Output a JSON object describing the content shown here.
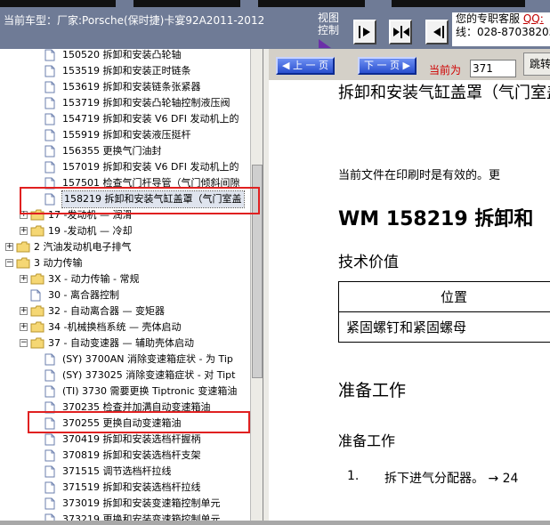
{
  "header": {
    "vehicle_label": "当前车型：厂家:Porsche(保时捷)卡宴92A2011-2012",
    "view_control_label": "视图控制",
    "contact_line1_prefix": "您的专职客服",
    "contact_line1_link": "QQ:",
    "contact_line2": "线：028-87038205"
  },
  "tree": {
    "items": [
      {
        "label": "150520 拆卸和安装凸轮轴",
        "type": "doc"
      },
      {
        "label": "153519 拆卸和安装正时链条",
        "type": "doc"
      },
      {
        "label": "153619 拆卸和安装链条张紧器",
        "type": "doc"
      },
      {
        "label": "153719 拆卸和安装凸轮轴控制液压阀",
        "type": "doc"
      },
      {
        "label": "154719 拆卸和安装 V6 DFI 发动机上的",
        "type": "doc"
      },
      {
        "label": "155919 拆卸和安装液压挺杆",
        "type": "doc"
      },
      {
        "label": "156355 更换气门油封",
        "type": "doc"
      },
      {
        "label": "157019 拆卸和安装 V6 DFI 发动机上的",
        "type": "doc"
      },
      {
        "label": "157501 检查气门杆导管（气门倾斜间隙",
        "type": "doc"
      },
      {
        "label": "158219 拆卸和安装气缸盖罩（气门室盖",
        "type": "doc",
        "selected": true
      },
      {
        "label": "17 -发动机 — 润滑",
        "type": "folder"
      },
      {
        "label": "19 -发动机 — 冷却",
        "type": "folder"
      },
      {
        "label": "2 汽油发动机电子排气",
        "type": "folder"
      },
      {
        "label": "3 动力传输",
        "type": "folder"
      },
      {
        "label": "3X - 动力传输 - 常规",
        "type": "folder"
      },
      {
        "label": "30 - 离合器控制",
        "type": "doc"
      },
      {
        "label": "32 - 自动离合器 — 变矩器",
        "type": "folder"
      },
      {
        "label": "34 -机械换档系统 — 壳体启动",
        "type": "folder"
      },
      {
        "label": "37 - 自动变速器 — 辅助壳体启动",
        "type": "folder"
      },
      {
        "label": "(SY) 3700AN 消除变速箱症状 - 为 Tip",
        "type": "doc"
      },
      {
        "label": "(SY) 373025 消除变速箱症状 - 对 Tipt",
        "type": "doc"
      },
      {
        "label": "(TI) 3730 需要更换 Tiptronic 变速箱油",
        "type": "doc"
      },
      {
        "label": "370235 检查并加满自动变速箱油",
        "type": "doc"
      },
      {
        "label": "370255 更换自动变速箱油",
        "type": "doc"
      },
      {
        "label": "370419 拆卸和安装选档杆握柄",
        "type": "doc"
      },
      {
        "label": "370819 拆卸和安装选档杆支架",
        "type": "doc"
      },
      {
        "label": "371515 调节选档杆拉线",
        "type": "doc"
      },
      {
        "label": "371519 拆卸和安装选档杆拉线",
        "type": "doc"
      },
      {
        "label": "373019 拆卸和安装变速箱控制单元",
        "type": "doc"
      },
      {
        "label": "373219 更换和安装变速箱控制单元",
        "type": "doc"
      }
    ]
  },
  "nav": {
    "prev_label": "上 一 页",
    "next_label": "下 一 页",
    "current_label": "当前为",
    "page_value": "371",
    "jump_label": "跳转"
  },
  "doc": {
    "title_top": "拆卸和安装气缸盖罩（气门室盖）",
    "note": "当前文件在印刷时是有效的。更",
    "heading": "WM 158219 拆卸和",
    "tech_values": "技术价值",
    "table_header": "位置",
    "table_row": "紧固螺钉和紧固螺母",
    "prep_h2": "准备工作",
    "prep_h3": "准备工作",
    "step_num": "1.",
    "step_text": "拆下进气分配器。 → 24"
  },
  "colors": {
    "topbar": "#6f7b96",
    "highlight_box": "#e02020",
    "nav_button": "#2a4fcf",
    "current_label": "#d00000"
  }
}
